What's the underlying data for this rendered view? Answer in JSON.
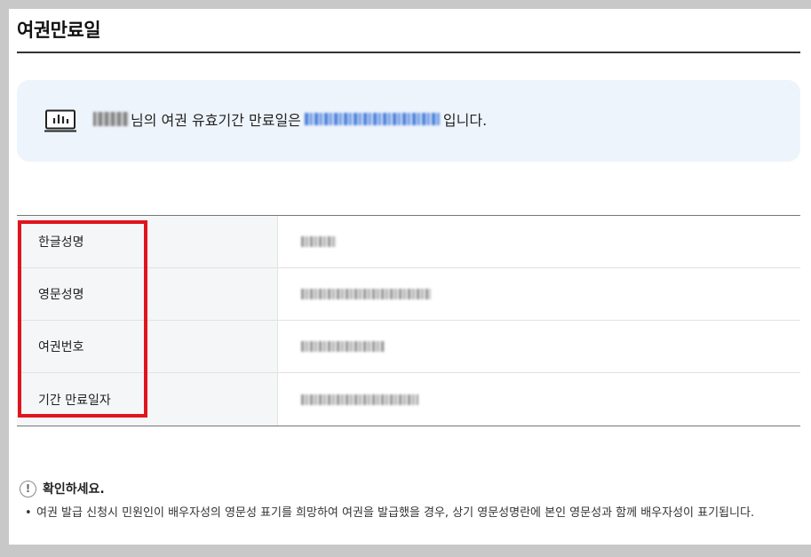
{
  "page_title": "여권만료일",
  "notice": {
    "name_suffix": "님의 여권 유효기간 만료일은",
    "suffix": "입니다."
  },
  "table": {
    "rows": [
      {
        "label": "한글성명"
      },
      {
        "label": "영문성명"
      },
      {
        "label": "여권번호"
      },
      {
        "label": "기간 만료일자"
      }
    ]
  },
  "check": {
    "title": "확인하세요.",
    "note": "여권 발급 신청시 민원인이 배우자성의 영문성 표기를 희망하여 여권을 발급했을 경우, 상기 영문성명란에 본인 영문성과 함께 배우자성이 표기됩니다."
  },
  "colors": {
    "accent_blue": "#2b6bd6",
    "highlight_red": "#e0141e",
    "notice_bg": "#eef4fb"
  },
  "icons": {
    "notice": "report-chart-icon",
    "check": "exclamation-circle-icon"
  }
}
